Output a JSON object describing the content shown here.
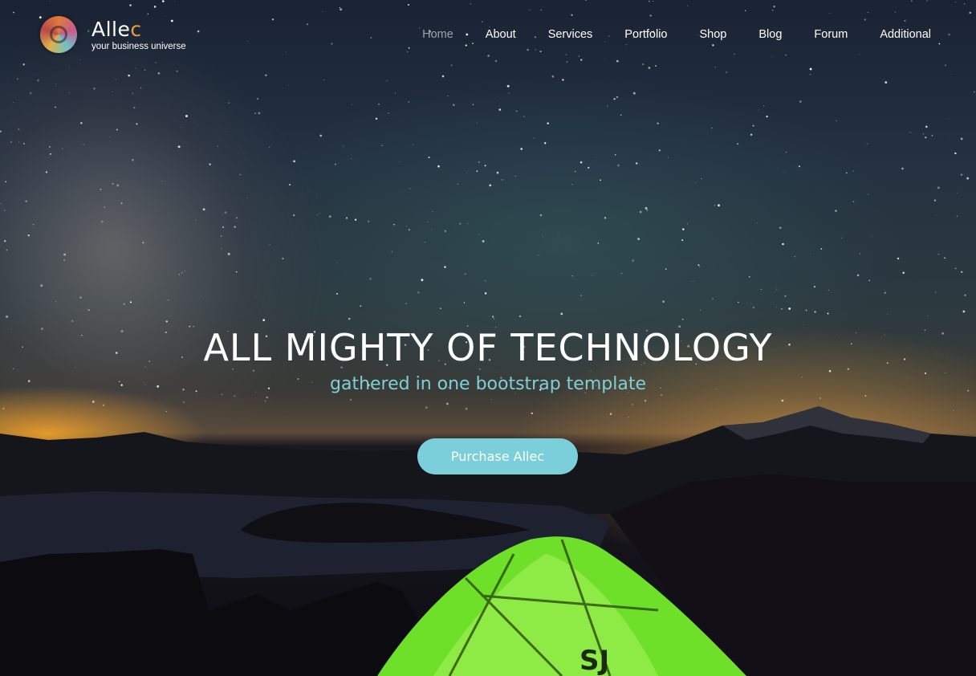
{
  "brand": {
    "name_main": "Alle",
    "name_accent": "c",
    "tagline": "your business universe",
    "logo_icon": "spiral-logo-icon"
  },
  "nav": {
    "items": [
      {
        "label": "Home",
        "active": true
      },
      {
        "label": "About",
        "active": false
      },
      {
        "label": "Services",
        "active": false
      },
      {
        "label": "Portfolio",
        "active": false
      },
      {
        "label": "Shop",
        "active": false
      },
      {
        "label": "Blog",
        "active": false
      },
      {
        "label": "Forum",
        "active": false
      },
      {
        "label": "Additional",
        "active": false
      }
    ]
  },
  "hero": {
    "headline": "ALL MIGHTY OF TECHNOLOGY",
    "subline": "gathered in one bootstrap template",
    "cta_label": "Purchase Allec",
    "background": "night-sky-camping-scene"
  },
  "colors": {
    "accent": "#7bcfda",
    "brand_accent": "#e8a13a",
    "nav_active": "#9aa3ad",
    "tent": "#6fe02a"
  }
}
